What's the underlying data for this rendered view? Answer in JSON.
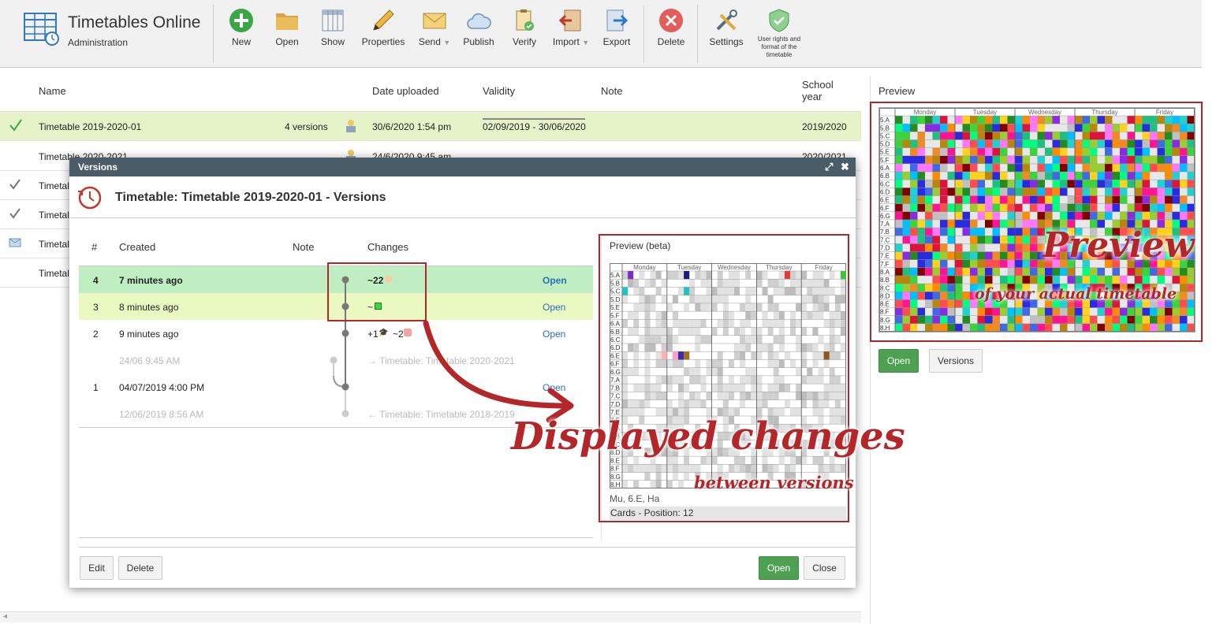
{
  "app": {
    "title": "Timetables Online",
    "subtitle": "Administration"
  },
  "toolbar": {
    "new": "New",
    "open": "Open",
    "show": "Show",
    "properties": "Properties",
    "send": "Send",
    "publish": "Publish",
    "verify": "Verify",
    "import": "Import",
    "export": "Export",
    "delete": "Delete",
    "settings": "Settings",
    "user_rights": "User rights and format of the timetable"
  },
  "grid": {
    "headers": {
      "name": "Name",
      "date_uploaded": "Date uploaded",
      "validity": "Validity",
      "note": "Note",
      "school_year": "School year"
    },
    "rows": [
      {
        "name": "Timetable 2019-2020-01",
        "versions": "4 versions",
        "date": "30/6/2020 1:54 pm",
        "validity": "02/09/2019 - 30/06/2020",
        "year": "2019/2020"
      },
      {
        "name": "Timetable 2020-2021",
        "date": "24/6/2020 9:45 am",
        "year": "2020/2021"
      },
      {
        "name": "Timetal"
      },
      {
        "name": "Timetal"
      },
      {
        "name": "Timetal"
      },
      {
        "name": "Timetal"
      }
    ]
  },
  "preview": {
    "label": "Preview",
    "open": "Open",
    "versions": "Versions",
    "days": [
      "Monday",
      "Tuesday",
      "Wednesday",
      "Thursday",
      "Friday"
    ],
    "classes": [
      "5.A",
      "5.B",
      "5.C",
      "5.D",
      "5.E",
      "5.F",
      "6.A",
      "6.B",
      "6.C",
      "6.D",
      "6.E",
      "6.F",
      "6.G",
      "7.A",
      "7.B",
      "7.C",
      "7.D",
      "7.E",
      "7.F",
      "8.A",
      "8.B",
      "8.C",
      "8.D",
      "8.E",
      "8.F",
      "8.G",
      "8.H"
    ]
  },
  "dialog": {
    "bar_title": "Versions",
    "title": "Timetable: Timetable 2019-2020-01 - Versions",
    "headers": {
      "num": "#",
      "created": "Created",
      "note": "Note",
      "changes": "Changes"
    },
    "rows": [
      {
        "num": "4",
        "created": "7 minutes ago",
        "changes": "~22",
        "open": "Open"
      },
      {
        "num": "3",
        "created": "8 minutes ago",
        "changes": "~",
        "open": "Open"
      },
      {
        "num": "2",
        "created": "9 minutes ago",
        "changes_a": "+1",
        "changes_b": "~2",
        "open": "Open"
      },
      {
        "created": "24/06 9:45 AM",
        "changes": "→ Timetable: Timetable 2020-2021"
      },
      {
        "num": "1",
        "created": "04/07/2019 4:00 PM",
        "open": "Open"
      },
      {
        "created": "12/06/2019 8:56 AM",
        "changes": "← Timetable: Timetable 2018-2019"
      }
    ],
    "preview_label": "Preview (beta)",
    "info1": "Mu, 6.E, Ha",
    "info2": "Cards - Position: 12",
    "buttons": {
      "edit": "Edit",
      "delete": "Delete",
      "open": "Open",
      "close": "Close"
    }
  },
  "annotations": {
    "big1": "Displayed changes",
    "small1": "between versions",
    "big2": "Preview",
    "small2": "of your actual timetable"
  }
}
